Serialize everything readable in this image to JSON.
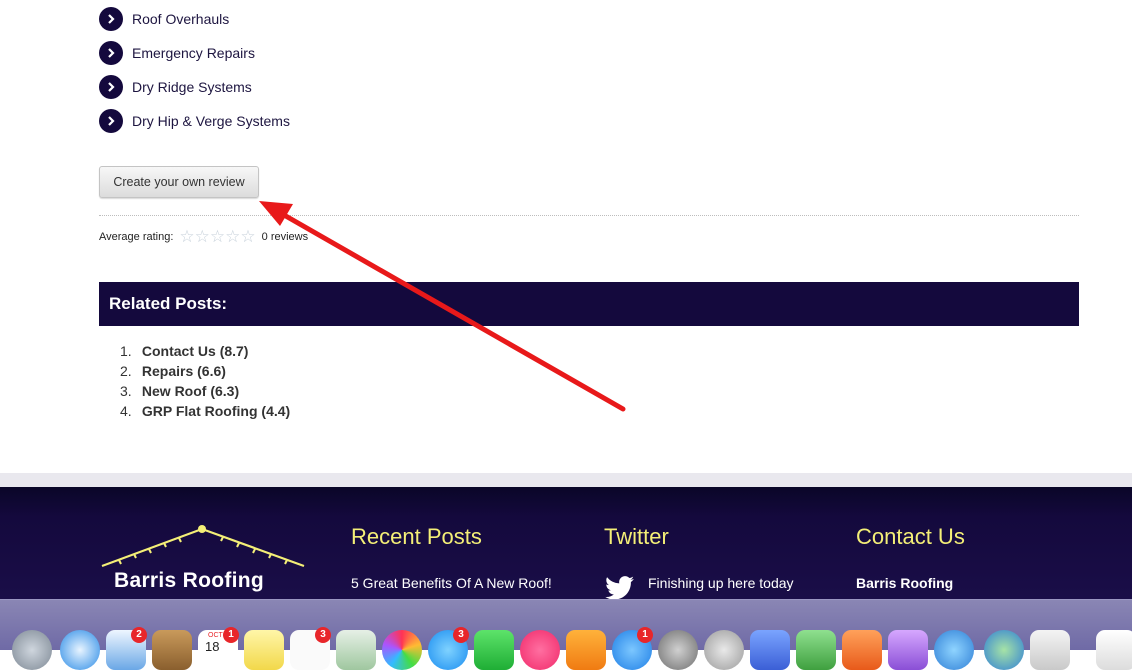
{
  "services": [
    {
      "label": "Roof Overhauls"
    },
    {
      "label": "Emergency Repairs"
    },
    {
      "label": "Dry Ridge Systems"
    },
    {
      "label": "Dry Hip & Verge Systems"
    }
  ],
  "review": {
    "button_label": "Create your own review",
    "average_label": "Average rating:",
    "rating": 0,
    "max_rating": 5,
    "reviews_count": "0 reviews"
  },
  "related": {
    "title": "Related Posts:",
    "items": [
      {
        "num": "1.",
        "title": "Contact Us",
        "score": "(8.7)"
      },
      {
        "num": "2.",
        "title": "Repairs",
        "score": "(6.6)"
      },
      {
        "num": "3.",
        "title": "New Roof",
        "score": "(6.3)"
      },
      {
        "num": "4.",
        "title": "GRP Flat Roofing",
        "score": "(4.4)"
      }
    ]
  },
  "footer": {
    "logo_text": "Barris Roofing",
    "recent_posts": {
      "heading": "Recent Posts",
      "first_post": "5 Great Benefits Of A New Roof!"
    },
    "twitter": {
      "heading": "Twitter",
      "tweet": "Finishing up here today"
    },
    "contact": {
      "heading": "Contact Us",
      "company": "Barris Roofing"
    }
  },
  "dock": {
    "badges": {
      "mail": "2",
      "calendar": "1",
      "reminders": "3",
      "messages": "3",
      "app_store": "1"
    },
    "calendar_month": "OCT",
    "calendar_day": "18"
  },
  "colors": {
    "brand_navy": "#14093d",
    "heading_yellow": "#f4ef77",
    "annotation_arrow": "#e8191a"
  }
}
